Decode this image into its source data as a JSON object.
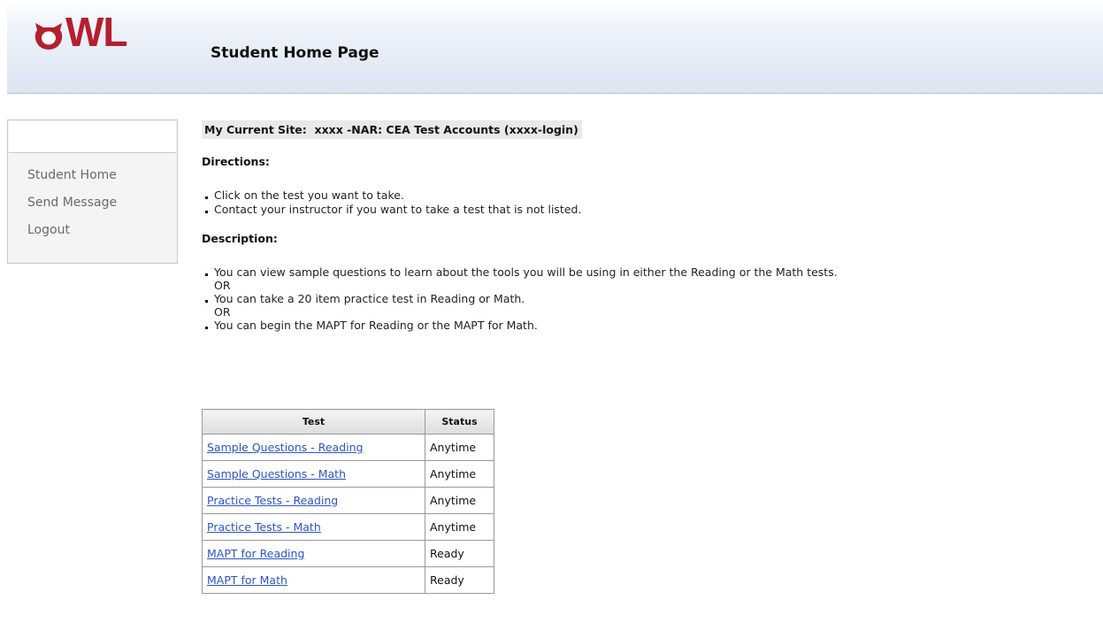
{
  "header": {
    "logo_text": "WL",
    "logo_icon": "owl-o-icon",
    "page_title": "Student Home Page",
    "brand_color": "#b41f2e"
  },
  "sidebar": {
    "items": [
      {
        "label": "Student Home"
      },
      {
        "label": "Send Message"
      },
      {
        "label": "Logout"
      }
    ]
  },
  "main": {
    "current_site_label": "My Current Site:",
    "current_site_value": "xxxx -NAR: CEA Test Accounts (xxxx-login)",
    "directions": {
      "heading": "Directions:",
      "items": [
        "Click on the test you want to take.",
        "Contact your instructor if you want to take a test that is not listed."
      ]
    },
    "description": {
      "heading": "Description:",
      "items": [
        "You can view sample questions to learn about the tools you will be using in either the Reading or the Math tests.",
        "You can take a 20 item practice test in Reading or Math.",
        "You can begin the MAPT for Reading or the MAPT for Math."
      ],
      "separator": "OR"
    },
    "table": {
      "columns": [
        "Test",
        "Status"
      ],
      "rows": [
        {
          "test": "Sample Questions - Reading",
          "status": "Anytime"
        },
        {
          "test": "Sample Questions - Math",
          "status": "Anytime"
        },
        {
          "test": "Practice Tests - Reading",
          "status": "Anytime"
        },
        {
          "test": "Practice Tests - Math",
          "status": "Anytime"
        },
        {
          "test": "MAPT for Reading",
          "status": "Ready"
        },
        {
          "test": "MAPT for Math",
          "status": "Ready"
        }
      ]
    }
  }
}
